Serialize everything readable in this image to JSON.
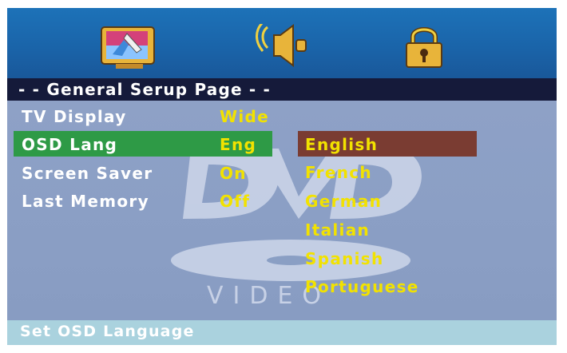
{
  "toolbar": {
    "icons": [
      {
        "name": "tv-settings-icon"
      },
      {
        "name": "speaker-icon"
      },
      {
        "name": "lock-icon"
      }
    ]
  },
  "page": {
    "title": "- - General Serup Page - -"
  },
  "menu": {
    "rows": [
      {
        "label": "TV Display",
        "value": "Wide"
      },
      {
        "label": "OSD Lang",
        "value": "Eng"
      },
      {
        "label": "Screen Saver",
        "value": "On"
      },
      {
        "label": "Last Memory",
        "value": "Off"
      }
    ]
  },
  "options": {
    "items": [
      "English",
      "French",
      "German",
      "Italian",
      "Spanish",
      "Portuguese"
    ],
    "selected": "English"
  },
  "status": {
    "text": "Set OSD Language"
  },
  "colors": {
    "topbar": "#1a63a8",
    "titlebar": "#151a3a",
    "content": "#8a9fc4",
    "highlight_row": "#2e9a46",
    "highlight_option": "#7a3c32",
    "value_text": "#f2e200",
    "statusbar": "#aad2de"
  }
}
